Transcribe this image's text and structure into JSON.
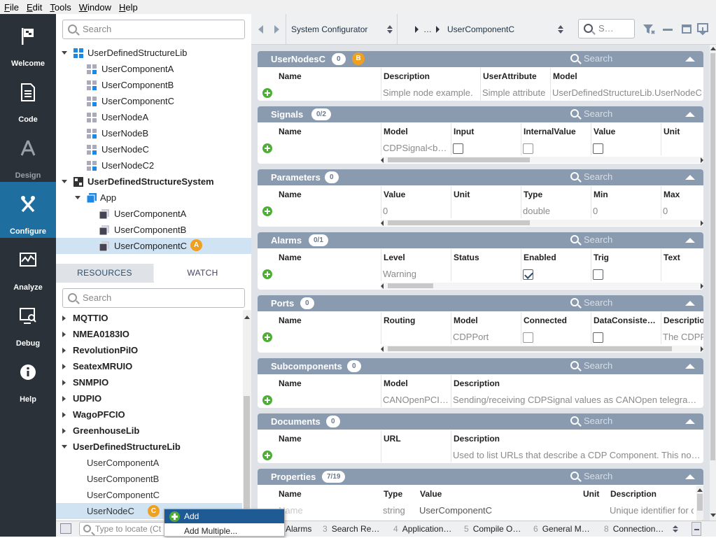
{
  "menubar": [
    "File",
    "Edit",
    "Tools",
    "Window",
    "Help"
  ],
  "nav": [
    {
      "label": "Welcome",
      "icon": "flag-icon"
    },
    {
      "label": "Code",
      "icon": "document-icon"
    },
    {
      "label": "Design",
      "icon": "design-icon"
    },
    {
      "label": "Configure",
      "icon": "wrench-screwdriver-icon"
    },
    {
      "label": "Analyze",
      "icon": "chart-icon"
    },
    {
      "label": "Debug",
      "icon": "bug-monitor-icon"
    },
    {
      "label": "Help",
      "icon": "info-icon"
    }
  ],
  "tree": {
    "search_placeholder": "Search",
    "items": [
      {
        "label": "UserDefinedStructureLib"
      },
      {
        "label": "UserComponentA"
      },
      {
        "label": "UserComponentB"
      },
      {
        "label": "UserComponentC"
      },
      {
        "label": "UserNodeA"
      },
      {
        "label": "UserNodeB"
      },
      {
        "label": "UserNodeC"
      },
      {
        "label": "UserNodeC2"
      },
      {
        "label": "UserDefinedStructureSystem"
      },
      {
        "label": "App"
      },
      {
        "label": "UserComponentA"
      },
      {
        "label": "UserComponentB"
      },
      {
        "label": "UserComponentC"
      }
    ],
    "badge": "A"
  },
  "tabs": {
    "resources": "RESOURCES",
    "watch": "WATCH"
  },
  "resources": {
    "search_placeholder": "Search",
    "items": [
      {
        "label": "MQTTIO"
      },
      {
        "label": "NMEA0183IO"
      },
      {
        "label": "RevolutionPiIO"
      },
      {
        "label": "SeatexMRUIO"
      },
      {
        "label": "SNMPIO"
      },
      {
        "label": "UDPIO"
      },
      {
        "label": "WagoPFCIO"
      },
      {
        "label": "GreenhouseLib"
      },
      {
        "label": "UserDefinedStructureLib"
      },
      {
        "label": "UserComponentA"
      },
      {
        "label": "UserComponentB"
      },
      {
        "label": "UserComponentC"
      },
      {
        "label": "UserNodeC"
      }
    ],
    "badge": "C"
  },
  "toolbar": {
    "context": "System Configurator",
    "breadcrumb_ellipsis": "…",
    "breadcrumb_item": "UserComponentC",
    "search_placeholder": "S…"
  },
  "panels": {
    "usernodes": {
      "title": "UserNodesC",
      "count": "0",
      "badge": "B",
      "search": "Search",
      "cols": [
        "Name",
        "Description",
        "UserAttribute",
        "Model"
      ],
      "row": [
        "Simple node example.",
        "Simple attribute",
        "UserDefinedStructureLib.UserNodeC"
      ]
    },
    "signals": {
      "title": "Signals",
      "count": "0/2",
      "search": "Search",
      "cols": [
        "Name",
        "Model",
        "Input",
        "InternalValue",
        "Value",
        "Unit"
      ],
      "row": [
        "CDPSignal<b…"
      ]
    },
    "parameters": {
      "title": "Parameters",
      "count": "0",
      "search": "Search",
      "cols": [
        "Name",
        "Value",
        "Unit",
        "Type",
        "Min",
        "Max"
      ],
      "row": [
        "0",
        "double",
        "0",
        "0"
      ]
    },
    "alarms": {
      "title": "Alarms",
      "count": "0/1",
      "search": "Search",
      "cols": [
        "Name",
        "Level",
        "Status",
        "Enabled",
        "Trig",
        "Text"
      ],
      "row": [
        "Warning"
      ]
    },
    "ports": {
      "title": "Ports",
      "count": "0",
      "search": "Search",
      "cols": [
        "Name",
        "Routing",
        "Model",
        "Connected",
        "DataConsiste…",
        "Descriptio"
      ],
      "row": [
        "CDPPort",
        "The CDPP"
      ]
    },
    "subcomponents": {
      "title": "Subcomponents",
      "count": "0",
      "search": "Search",
      "cols": [
        "Name",
        "Model",
        "Description"
      ],
      "row": [
        "CANOpenPCI…",
        "Sending/receiving CDPSignal values as CANOpen telegra…"
      ]
    },
    "documents": {
      "title": "Documents",
      "count": "0",
      "search": "Search",
      "cols": [
        "Name",
        "URL",
        "Description"
      ],
      "row": [
        "Used to list URLs that describe a CDP Component. This no…"
      ]
    },
    "properties": {
      "title": "Properties",
      "count": "7/19",
      "search": "Search",
      "cols": [
        "Name",
        "Type",
        "Value",
        "Unit",
        "Description"
      ],
      "row": [
        "Name",
        "string",
        "UserComponentC",
        "Unique identifier for c"
      ]
    }
  },
  "bottom": {
    "locate_placeholder": "Type to locate (Ct",
    "tabs": [
      {
        "num": "",
        "label": "Alarms"
      },
      {
        "num": "3",
        "label": "Search Re…"
      },
      {
        "num": "4",
        "label": "Application…"
      },
      {
        "num": "5",
        "label": "Compile O…"
      },
      {
        "num": "6",
        "label": "General M…"
      },
      {
        "num": "8",
        "label": "Connection…"
      }
    ]
  },
  "context_menu": {
    "add": "Add",
    "add_multiple": "Add Multiple..."
  }
}
